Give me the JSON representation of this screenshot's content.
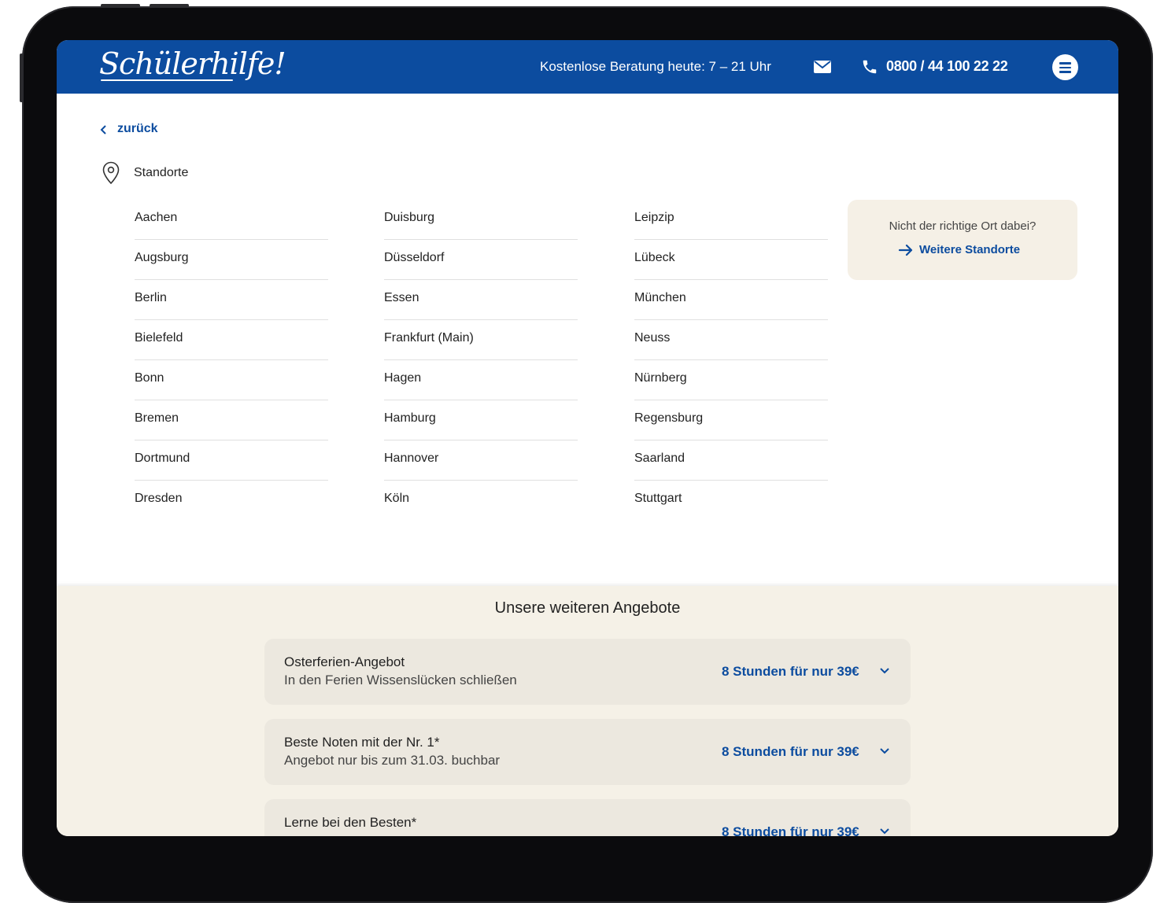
{
  "header": {
    "logo": "Schülerhilfe!",
    "hours": "Kostenlose Beratung heute: 7 – 21 Uhr",
    "phone": "0800 / 44 100 22 22"
  },
  "nav": {
    "back_label": "zurück"
  },
  "locations": {
    "heading": "Standorte",
    "columns": [
      [
        "Aachen",
        "Augsburg",
        "Berlin",
        "Bielefeld",
        "Bonn",
        "Bremen",
        "Dortmund",
        "Dresden"
      ],
      [
        "Duisburg",
        "Düsseldorf",
        "Essen",
        "Frankfurt (Main)",
        "Hagen",
        "Hamburg",
        "Hannover",
        "Köln"
      ],
      [
        "Leipzip",
        "Lübeck",
        "München",
        "Neuss",
        "Nürnberg",
        "Regensburg",
        "Saarland",
        "Stuttgart"
      ]
    ]
  },
  "more_locations": {
    "question": "Nicht der richtige Ort dabei?",
    "link": "Weitere Standorte"
  },
  "offers": {
    "title": "Unsere weiteren Angebote",
    "items": [
      {
        "title": "Osterferien-Angebot",
        "subtitle": "In den Ferien Wissenslücken schließen",
        "price": "8 Stunden für nur 39€"
      },
      {
        "title": "Beste Noten mit der Nr. 1*",
        "subtitle": "Angebot nur bis zum 31.03. buchbar",
        "price": "8 Stunden für nur 39€"
      },
      {
        "title": "Lerne bei den Besten*",
        "subtitle": "",
        "price": "8 Stunden für nur 39€"
      }
    ]
  },
  "colors": {
    "brand_blue": "#0c4c9f",
    "beige": "#f5f1e7",
    "card": "#ece8df"
  },
  "icons": [
    "mail-icon",
    "phone-icon",
    "menu-icon",
    "chevron-left-icon",
    "map-pin-icon",
    "arrow-right-icon",
    "chevron-down-icon"
  ]
}
